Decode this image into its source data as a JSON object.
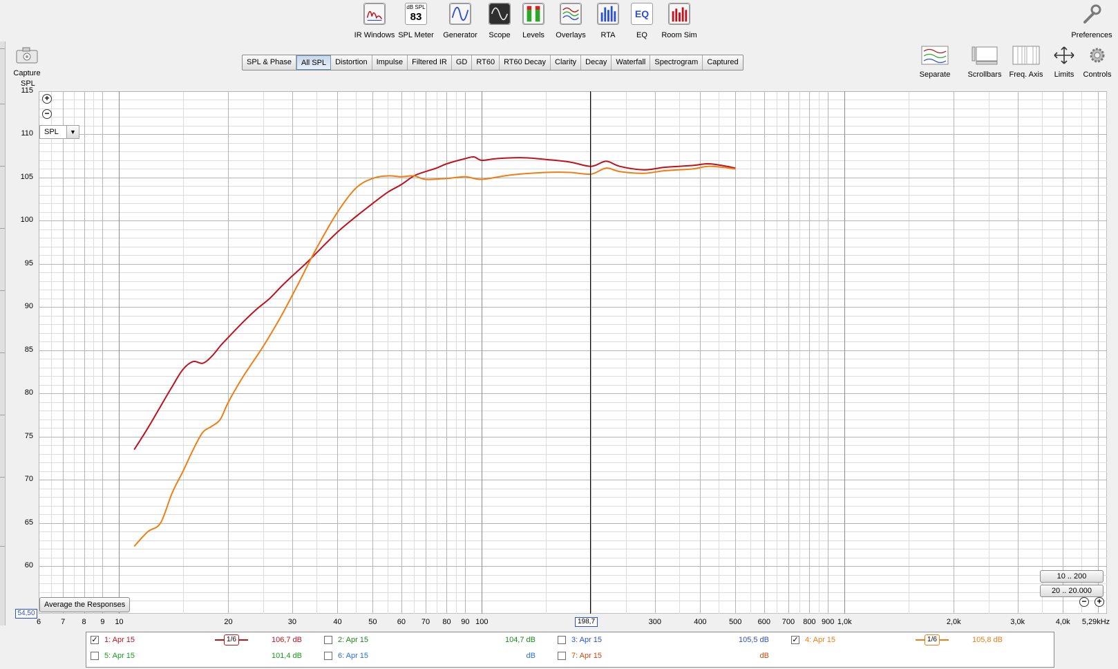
{
  "toolbar": {
    "items": [
      {
        "label": "IR Windows",
        "icon": "ir-windows-icon"
      },
      {
        "label": "SPL Meter",
        "icon": "spl-meter-icon",
        "meter_unit": "dB SPL",
        "meter_value": "83"
      },
      {
        "label": "Generator",
        "icon": "generator-icon"
      },
      {
        "label": "Scope",
        "icon": "scope-icon"
      },
      {
        "label": "Levels",
        "icon": "levels-icon"
      },
      {
        "label": "Overlays",
        "icon": "overlays-icon"
      },
      {
        "label": "RTA",
        "icon": "rta-icon"
      },
      {
        "label": "EQ",
        "icon": "eq-icon",
        "badge": "EQ"
      },
      {
        "label": "Room Sim",
        "icon": "room-sim-icon"
      }
    ],
    "preferences": "Preferences"
  },
  "capture": "Capture",
  "tabs": [
    "SPL & Phase",
    "All SPL",
    "Distortion",
    "Impulse",
    "Filtered IR",
    "GD",
    "RT60",
    "RT60 Decay",
    "Clarity",
    "Decay",
    "Waterfall",
    "Spectrogram",
    "Captured"
  ],
  "active_tab": "All SPL",
  "right_tools": [
    "Separate",
    "Scrollbars",
    "Freq. Axis",
    "Limits",
    "Controls"
  ],
  "plot": {
    "y_axis_label": "SPL",
    "y_select": "SPL",
    "average_button": "Average the Responses",
    "range_buttons": [
      "10 .. 200",
      "20 .. 20.000"
    ],
    "y_cursor": "54,50",
    "x_cursor": "198,7"
  },
  "colors": {
    "series1": "#c0111a",
    "series4": "#f07d12",
    "series2": "#1a8a1a",
    "series3": "#2a4fd6",
    "series5": "#1a9a1a",
    "series6": "#2a6fd6",
    "series7": "#c84a10",
    "grid_major": "#b4b4b4",
    "grid_minor": "#dcdcdc",
    "cursor_box": "#2a4fd6"
  },
  "chart_data": {
    "type": "line",
    "title": "",
    "xlabel": "",
    "ylabel": "SPL",
    "x_scale": "log",
    "xlim": [
      6,
      5290
    ],
    "ylim": [
      54.5,
      115
    ],
    "y_ticks": [
      115,
      110,
      105,
      100,
      95,
      90,
      85,
      80,
      75,
      70,
      65,
      60
    ],
    "x_ticks": [
      {
        "v": 6,
        "t": "6"
      },
      {
        "v": 7,
        "t": "7"
      },
      {
        "v": 8,
        "t": "8"
      },
      {
        "v": 9,
        "t": "9"
      },
      {
        "v": 10,
        "t": "10"
      },
      {
        "v": 20,
        "t": "20"
      },
      {
        "v": 30,
        "t": "30"
      },
      {
        "v": 40,
        "t": "40"
      },
      {
        "v": 50,
        "t": "50"
      },
      {
        "v": 60,
        "t": "60"
      },
      {
        "v": 70,
        "t": "70"
      },
      {
        "v": 80,
        "t": "80"
      },
      {
        "v": 90,
        "t": "90"
      },
      {
        "v": 100,
        "t": "100"
      },
      {
        "v": 300,
        "t": "300"
      },
      {
        "v": 400,
        "t": "400"
      },
      {
        "v": 500,
        "t": "500"
      },
      {
        "v": 600,
        "t": "600"
      },
      {
        "v": 700,
        "t": "700"
      },
      {
        "v": 800,
        "t": "800"
      },
      {
        "v": 900,
        "t": "900"
      },
      {
        "v": 1000,
        "t": "1,0k"
      },
      {
        "v": 2000,
        "t": "2,0k"
      },
      {
        "v": 3000,
        "t": "3,0k"
      },
      {
        "v": 4000,
        "t": "4,0k"
      },
      {
        "v": 5290,
        "t": "5,29kHz"
      }
    ],
    "cursor_x": 198.7,
    "grid": true,
    "series": [
      {
        "name": "1: Apr 15",
        "color": "#c0111a",
        "points": [
          [
            11,
            73.5
          ],
          [
            12,
            76.0
          ],
          [
            13,
            78.5
          ],
          [
            14,
            80.8
          ],
          [
            15,
            82.8
          ],
          [
            16,
            83.7
          ],
          [
            17,
            83.5
          ],
          [
            18,
            84.3
          ],
          [
            19,
            85.5
          ],
          [
            20,
            86.5
          ],
          [
            22,
            88.3
          ],
          [
            24,
            89.8
          ],
          [
            26,
            91.0
          ],
          [
            28,
            92.4
          ],
          [
            30,
            93.6
          ],
          [
            33,
            95.2
          ],
          [
            36,
            96.8
          ],
          [
            40,
            98.7
          ],
          [
            45,
            100.5
          ],
          [
            50,
            102.0
          ],
          [
            55,
            103.3
          ],
          [
            60,
            104.2
          ],
          [
            65,
            105.2
          ],
          [
            70,
            105.7
          ],
          [
            75,
            106.1
          ],
          [
            80,
            106.6
          ],
          [
            90,
            107.2
          ],
          [
            95,
            107.4
          ],
          [
            100,
            107.0
          ],
          [
            110,
            107.2
          ],
          [
            130,
            107.3
          ],
          [
            150,
            107.1
          ],
          [
            175,
            106.8
          ],
          [
            200,
            106.3
          ],
          [
            220,
            106.9
          ],
          [
            240,
            106.3
          ],
          [
            280,
            105.9
          ],
          [
            320,
            106.2
          ],
          [
            380,
            106.4
          ],
          [
            420,
            106.6
          ],
          [
            460,
            106.4
          ],
          [
            500,
            106.1
          ]
        ]
      },
      {
        "name": "4: Apr 15",
        "color": "#f07d12",
        "points": [
          [
            11,
            62.3
          ],
          [
            12,
            64.0
          ],
          [
            13,
            65.0
          ],
          [
            14,
            68.5
          ],
          [
            15,
            71.0
          ],
          [
            16,
            73.5
          ],
          [
            17,
            75.5
          ],
          [
            18,
            76.2
          ],
          [
            19,
            77.0
          ],
          [
            20,
            79.0
          ],
          [
            22,
            82.0
          ],
          [
            25,
            85.5
          ],
          [
            28,
            89.0
          ],
          [
            31,
            92.5
          ],
          [
            35,
            96.8
          ],
          [
            40,
            101.0
          ],
          [
            45,
            103.8
          ],
          [
            50,
            104.9
          ],
          [
            55,
            105.2
          ],
          [
            60,
            105.1
          ],
          [
            65,
            105.2
          ],
          [
            70,
            104.8
          ],
          [
            80,
            104.9
          ],
          [
            90,
            105.1
          ],
          [
            100,
            104.8
          ],
          [
            120,
            105.3
          ],
          [
            150,
            105.6
          ],
          [
            175,
            105.6
          ],
          [
            200,
            105.4
          ],
          [
            220,
            106.1
          ],
          [
            240,
            105.7
          ],
          [
            280,
            105.5
          ],
          [
            320,
            105.8
          ],
          [
            380,
            106.0
          ],
          [
            420,
            106.3
          ],
          [
            460,
            106.2
          ],
          [
            500,
            106.0
          ]
        ]
      }
    ]
  },
  "legend": [
    {
      "label": "1: Apr 15",
      "checked": true,
      "value": "106,7 dB",
      "color": "#c0111a",
      "smoothing": "1/6"
    },
    {
      "label": "2: Apr 15",
      "checked": false,
      "value": "104,7 dB",
      "color": "#1a8a1a"
    },
    {
      "label": "3: Apr 15",
      "checked": false,
      "value": "105,5 dB",
      "color": "#2a4fd6"
    },
    {
      "label": "4: Apr 15",
      "checked": true,
      "value": "105,8 dB",
      "color": "#f07d12",
      "smoothing": "1/6"
    },
    {
      "label": "5: Apr 15",
      "checked": false,
      "value": "101,4 dB",
      "color": "#1a9a1a"
    },
    {
      "label": "6: Apr 15",
      "checked": false,
      "value": "dB",
      "color": "#2a6fd6"
    },
    {
      "label": "7: Apr 15",
      "checked": false,
      "value": "dB",
      "color": "#c84a10"
    }
  ]
}
